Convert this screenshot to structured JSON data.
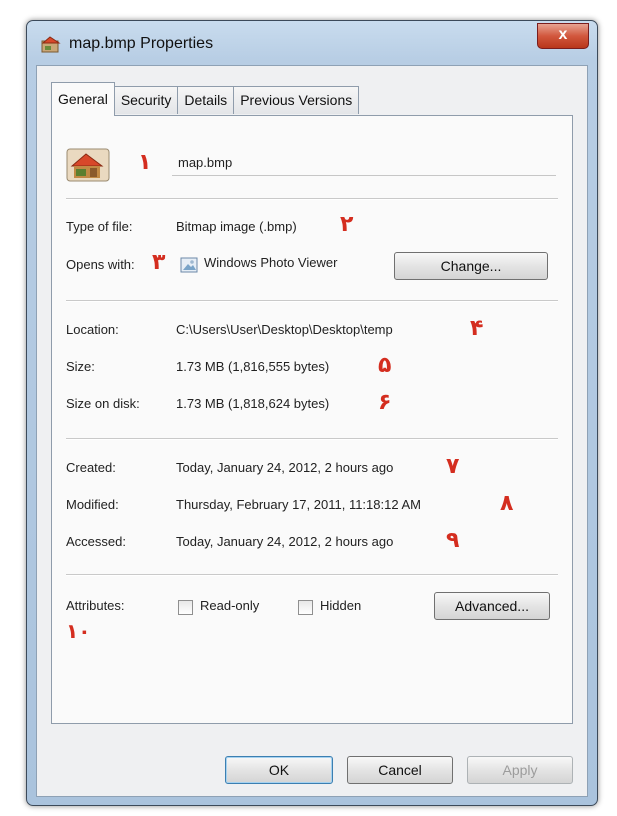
{
  "window": {
    "title": "map.bmp Properties",
    "close_glyph": "x"
  },
  "tabs": [
    {
      "label": "General",
      "active": true
    },
    {
      "label": "Security",
      "active": false
    },
    {
      "label": "Details",
      "active": false
    },
    {
      "label": "Previous Versions",
      "active": false
    }
  ],
  "general": {
    "file_name": "map.bmp",
    "type_label": "Type of file:",
    "type_value": "Bitmap image (.bmp)",
    "opens_label": "Opens with:",
    "opens_value": "Windows Photo Viewer",
    "change_button": "Change...",
    "location_label": "Location:",
    "location_value": "C:\\Users\\User\\Desktop\\Desktop\\temp",
    "size_label": "Size:",
    "size_value": "1.73 MB (1,816,555 bytes)",
    "size_disk_label": "Size on disk:",
    "size_disk_value": "1.73 MB (1,818,624 bytes)",
    "created_label": "Created:",
    "created_value": "Today, January 24, 2012, 2 hours ago",
    "modified_label": "Modified:",
    "modified_value": "Thursday, February 17, 2011, 11:18:12 AM",
    "accessed_label": "Accessed:",
    "accessed_value": "Today, January 24, 2012, 2 hours ago",
    "attributes_label": "Attributes:",
    "readonly_label": "Read-only",
    "readonly_checked": false,
    "hidden_label": "Hidden",
    "hidden_checked": false,
    "advanced_button": "Advanced..."
  },
  "footer": {
    "ok": "OK",
    "cancel": "Cancel",
    "apply": "Apply"
  },
  "annotations": [
    "۱",
    "۲",
    "۳",
    "۴",
    "۵",
    "۶",
    "۷",
    "۸",
    "۹",
    "۱۰"
  ],
  "colors": {
    "annotation": "#d42d1f",
    "title_bar": "#b7cde4",
    "close_button": "#d2573d"
  }
}
